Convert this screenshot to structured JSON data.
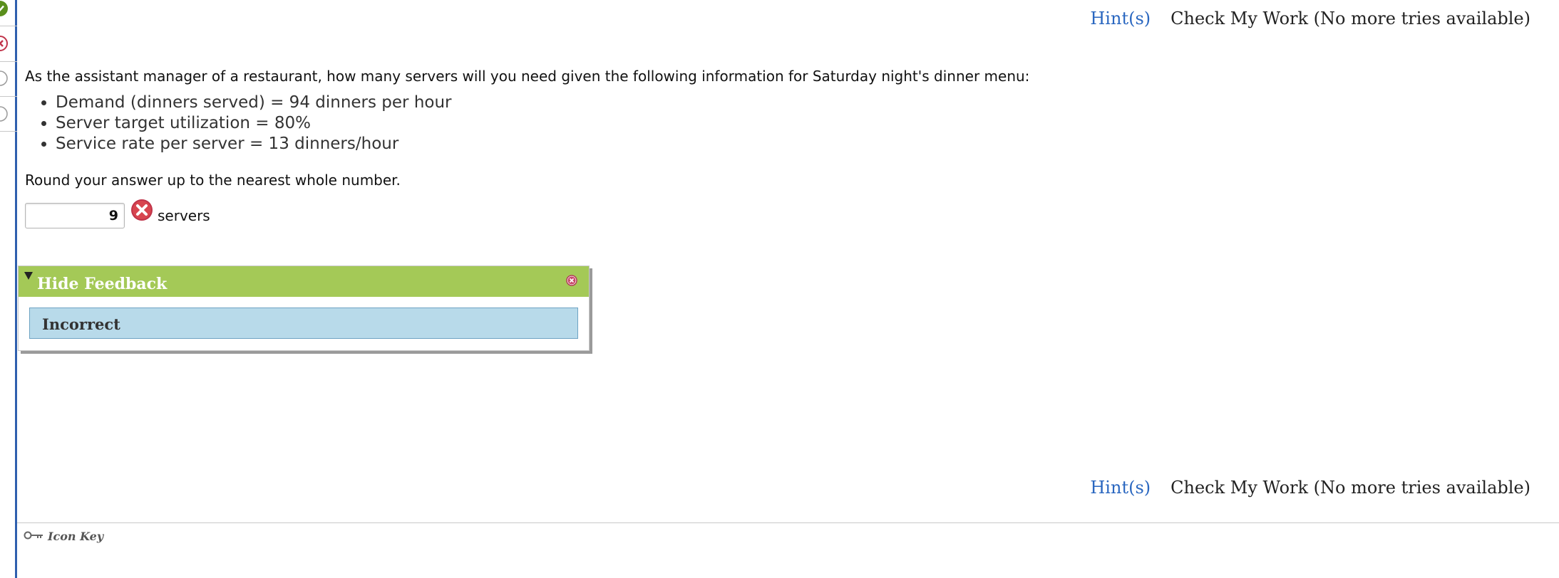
{
  "rail": {
    "items": [
      {
        "status": "correct",
        "icon": "check-circle-icon",
        "color": "#5a8f1c"
      },
      {
        "status": "incorrect",
        "icon": "x-circle-icon",
        "color": "#c0344a"
      },
      {
        "status": "unanswered",
        "icon": "empty-circle-icon",
        "color": "#9a9a9a"
      },
      {
        "status": "unanswered",
        "icon": "empty-circle-icon",
        "color": "#9a9a9a"
      }
    ]
  },
  "top_actions": {
    "hint_label": "Hint(s)",
    "check_label": "Check My Work (No more tries available)"
  },
  "bottom_actions": {
    "hint_label": "Hint(s)",
    "check_label": "Check My Work (No more tries available)"
  },
  "question": {
    "prompt": "As the assistant manager of a restaurant, how many servers will you need given the following information for Saturday night's dinner menu:",
    "bullets": [
      "Demand (dinners served) = 94 dinners per hour",
      "Server target utilization = 80%",
      "Service rate per server = 13 dinners/hour"
    ],
    "instruction": "Round your answer up to the nearest whole number."
  },
  "answer": {
    "value": "9",
    "unit": "servers",
    "result_icon": "wrong-answer-icon"
  },
  "feedback": {
    "toggle_label": "Hide Feedback",
    "status": "Incorrect",
    "header_color": "#a4c957",
    "body_color": "#b8daea"
  },
  "footer": {
    "icon_key_label": "Icon Key",
    "icon": "key-icon"
  },
  "colors": {
    "link": "#2a67c0",
    "rail_border": "#2f5fae",
    "error": "#c0344a"
  }
}
